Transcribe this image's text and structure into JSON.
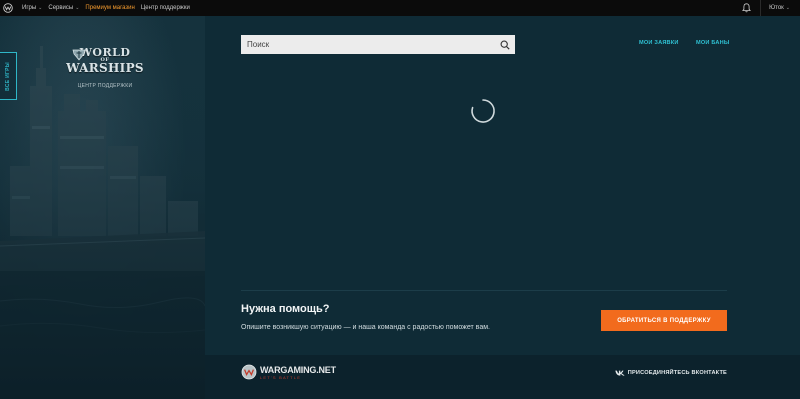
{
  "topbar": {
    "nav": [
      {
        "label": "Игры",
        "has_menu": true
      },
      {
        "label": "Сервисы",
        "has_menu": true
      },
      {
        "label": "Премиум магазин",
        "has_menu": false
      },
      {
        "label": "Центр поддержки",
        "has_menu": false
      }
    ],
    "user_label": "Юток",
    "chevron": "⌄",
    "icons": {
      "logo": "wargaming-globe-icon",
      "bell": "bell-icon"
    }
  },
  "sidebar": {
    "all_games_label": "ВСЕ ИГРЫ",
    "logo": {
      "line1": "WORLD",
      "line2": "OF",
      "line3": "WARSHIPS"
    },
    "support_caption": "ЦЕНТР ПОДДЕРЖКИ"
  },
  "header": {
    "search_placeholder": "Поиск",
    "links": {
      "my_requests": "МОИ ЗАЯВКИ",
      "my_bans": "МОИ БАНЫ"
    }
  },
  "loading": {
    "icon": "spinner-icon"
  },
  "help": {
    "title": "Нужна помощь?",
    "description": "Опишите возникшую ситуацию — и наша команда с радостью поможет вам.",
    "button_label": "ОБРАТИТЬСЯ В ПОДДЕРЖКУ"
  },
  "footer": {
    "brand_name": "WARGAMING.NET",
    "brand_slogan": "LET'S BATTLE",
    "vk_label": "ПРИСОЕДИНЯЙТЕСЬ ВКОНТАКТЕ"
  },
  "colors": {
    "accent_cyan": "#2fc0d2",
    "accent_orange": "#f26b1d",
    "premium": "#f39a2e",
    "bg_main": "#0f2b36",
    "bg_topbar": "#0b0b0b"
  }
}
